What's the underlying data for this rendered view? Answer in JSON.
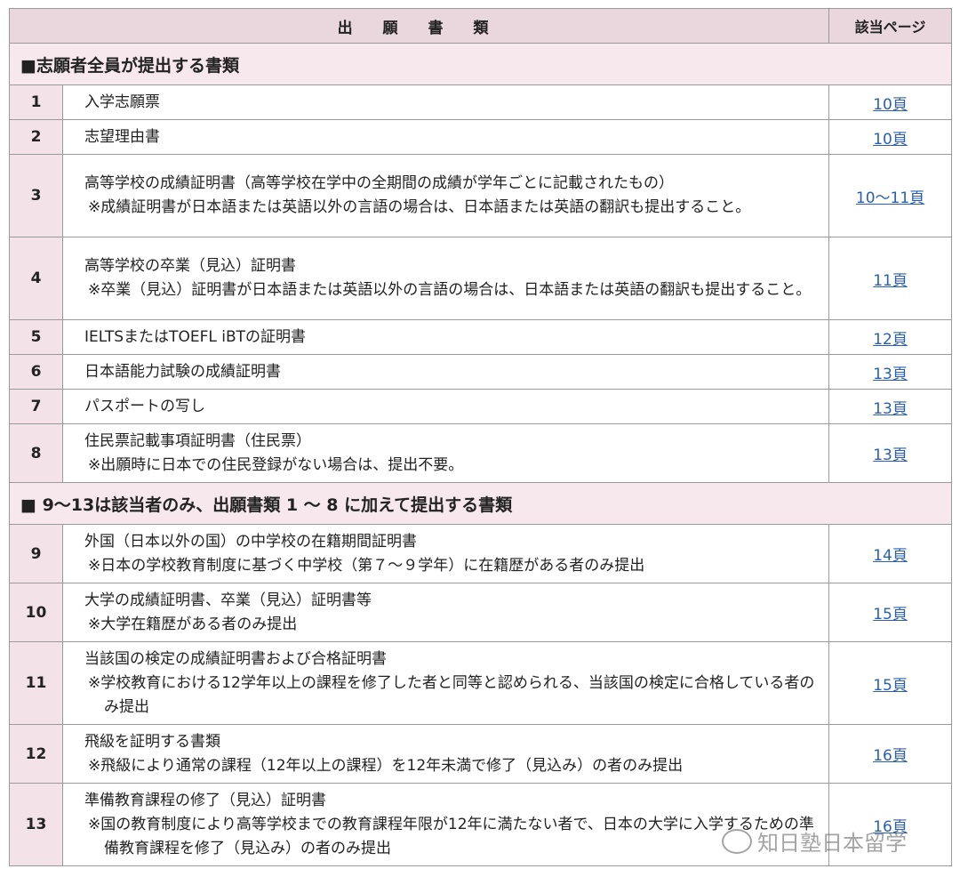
{
  "header": {
    "docs": "出 願 書 類",
    "page": "該当ページ"
  },
  "sections": [
    {
      "title": "■志願者全員が提出する書類"
    },
    {
      "title": "■ 9～13は該当者のみ、出願書類 1 ～ 8 に加えて提出する書類"
    }
  ],
  "rows": [
    {
      "num": "1",
      "doc": "入学志願票",
      "note": "",
      "page": "10頁"
    },
    {
      "num": "2",
      "doc": "志望理由書",
      "note": "",
      "page": "10頁"
    },
    {
      "num": "3",
      "doc": "高等学校の成績証明書（高等学校在学中の全期間の成績が学年ごとに記載されたもの）",
      "note": "※成績証明書が日本語または英語以外の言語の場合は、日本語または英語の翻訳も提出すること。",
      "page": "10～11頁"
    },
    {
      "num": "4",
      "doc": "高等学校の卒業（見込）証明書",
      "note": "※卒業（見込）証明書が日本語または英語以外の言語の場合は、日本語または英語の翻訳も提出すること。",
      "page": "11頁"
    },
    {
      "num": "5",
      "doc": "IELTSまたはTOEFL iBTの証明書",
      "note": "",
      "page": "12頁"
    },
    {
      "num": "6",
      "doc": "日本語能力試験の成績証明書",
      "note": "",
      "page": "13頁"
    },
    {
      "num": "7",
      "doc": "パスポートの写し",
      "note": "",
      "page": "13頁"
    },
    {
      "num": "8",
      "doc": "住民票記載事項証明書（住民票）",
      "note": "※出願時に日本での住民登録がない場合は、提出不要。",
      "page": "13頁"
    },
    {
      "num": "9",
      "doc": "外国（日本以外の国）の中学校の在籍期間証明書",
      "note": "※日本の学校教育制度に基づく中学校（第７～９学年）に在籍歴がある者のみ提出",
      "page": "14頁"
    },
    {
      "num": "10",
      "doc": "大学の成績証明書、卒業（見込）証明書等",
      "note": "※大学在籍歴がある者のみ提出",
      "page": "15頁"
    },
    {
      "num": "11",
      "doc": "当該国の検定の成績証明書および合格証明書",
      "note": "※学校教育における12学年以上の課程を修了した者と同等と認められる、当該国の検定に合格している者のみ提出",
      "page": "15頁"
    },
    {
      "num": "12",
      "doc": "飛級を証明する書類",
      "note": "※飛級により通常の課程（12年以上の課程）を12年未満で修了（見込み）の者のみ提出",
      "page": "16頁"
    },
    {
      "num": "13",
      "doc": "準備教育課程の修了（見込）証明書",
      "note": "※国の教育制度により高等学校までの教育課程年限が12年に満たない者で、日本の大学に入学するための準備教育課程を修了（見込み）の者のみ提出",
      "page": "16頁"
    }
  ],
  "watermark": "知日塾日本留学"
}
